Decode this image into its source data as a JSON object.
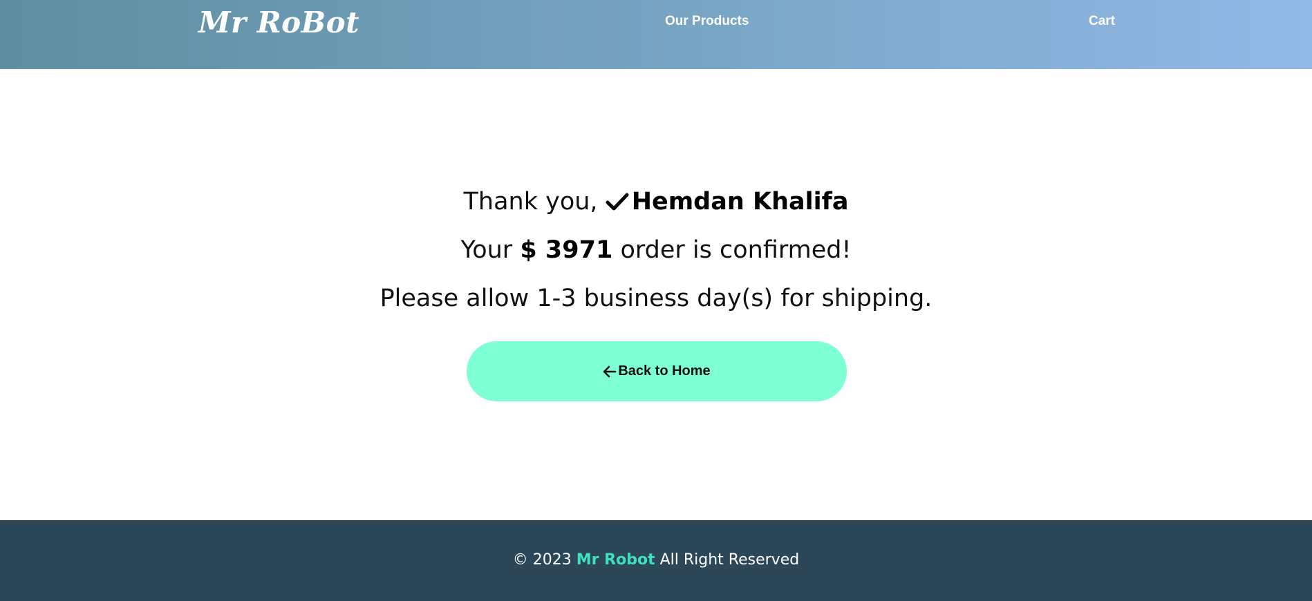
{
  "header": {
    "logo": "Mr RoBot",
    "nav": {
      "products_label": "Our Products",
      "cart_label": "Cart"
    }
  },
  "confirmation": {
    "thanks_prefix": "Thank you,",
    "customer_name": "Hemdan Khalifa",
    "order_prefix": "Your",
    "order_amount": "$ 3971",
    "order_suffix": "order is confirmed!",
    "shipping_message": "Please allow 1-3 business day(s) for shipping.",
    "back_button_label": "Back to Home",
    "check_icon": "check-icon",
    "back_icon": "arrow-left-icon"
  },
  "footer": {
    "copyright": "© 2023",
    "brand": "Mr Robot",
    "rights": "All Right Reserved"
  },
  "colors": {
    "button_bg": "#7fffd4",
    "footer_bg": "#2c4858",
    "brand_accent": "#3fe0c0",
    "header_gradient_start": "#5e8ea0",
    "header_gradient_end": "#92b8e6"
  }
}
